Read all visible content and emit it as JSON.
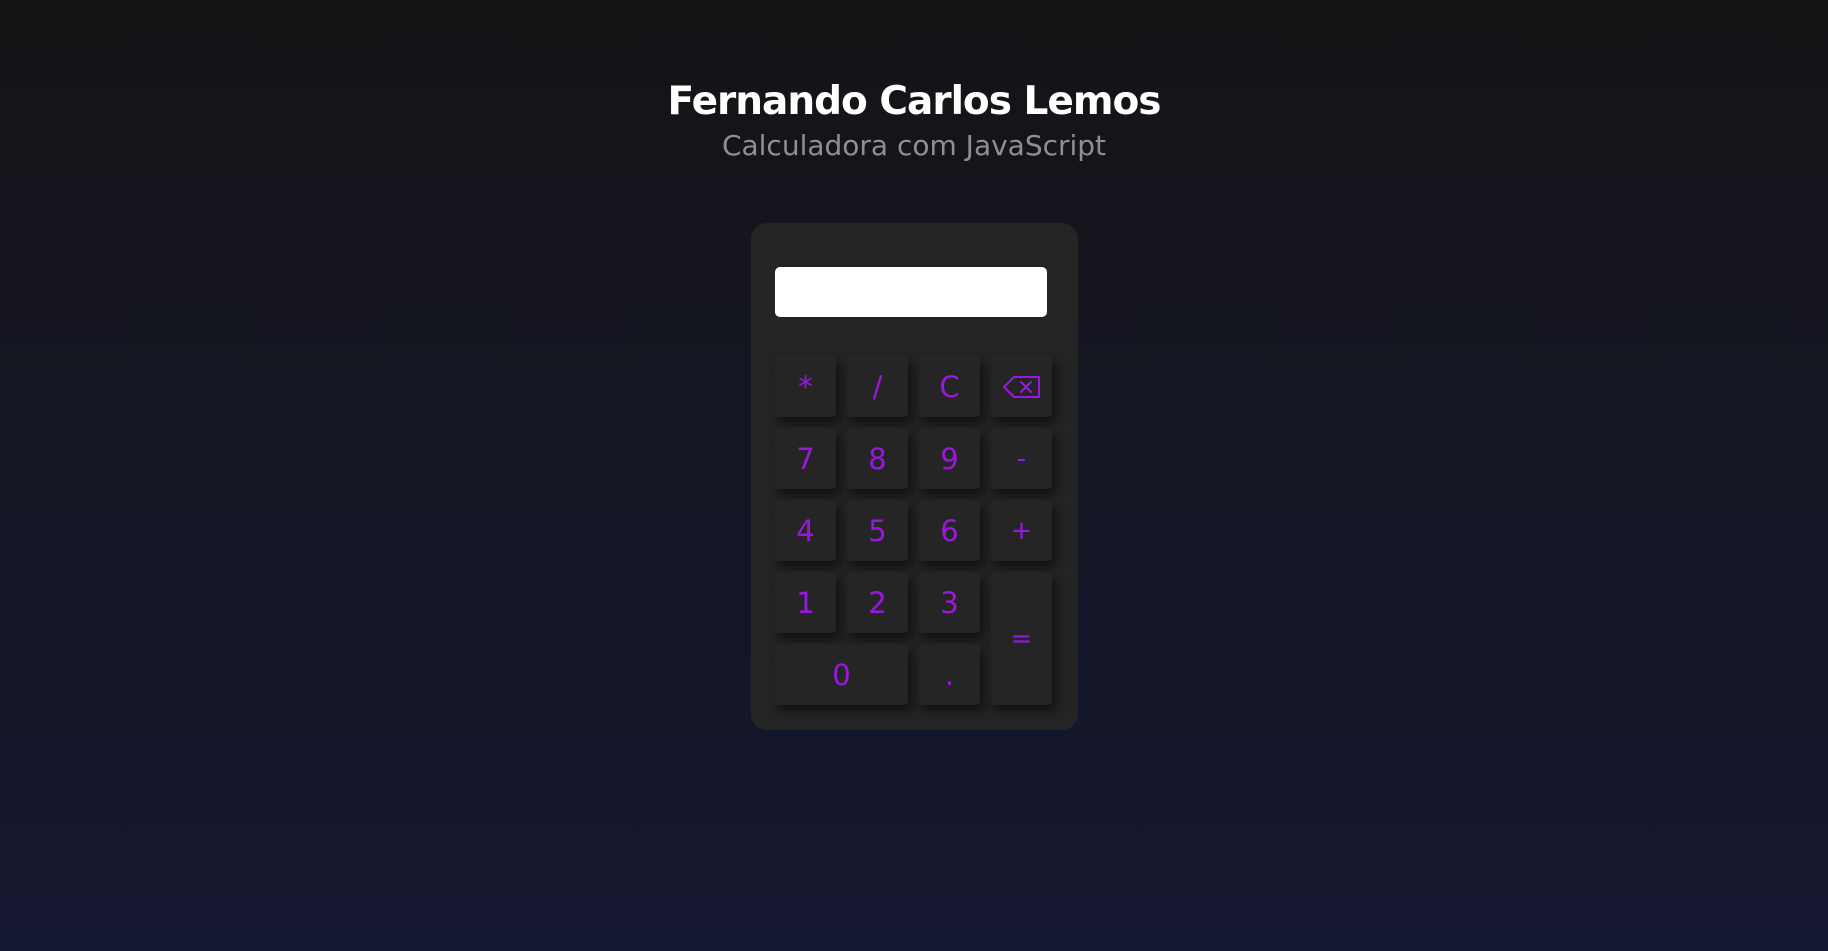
{
  "header": {
    "title": "Fernando Carlos Lemos",
    "subtitle": "Calculadora com JavaScript"
  },
  "display": {
    "value": ""
  },
  "keys": {
    "multiply": "*",
    "divide": "/",
    "clear": "C",
    "backspace_icon": "backspace-icon",
    "seven": "7",
    "eight": "8",
    "nine": "9",
    "minus": "-",
    "four": "4",
    "five": "5",
    "six": "6",
    "plus": "+",
    "one": "1",
    "two": "2",
    "three": "3",
    "equals": "=",
    "zero": "0",
    "dot": "."
  },
  "colors": {
    "accent": "#9a17e0",
    "calculator_bg": "#242424",
    "key_bg": "#252525",
    "title": "#ffffff",
    "subtitle": "#8e8e93"
  }
}
